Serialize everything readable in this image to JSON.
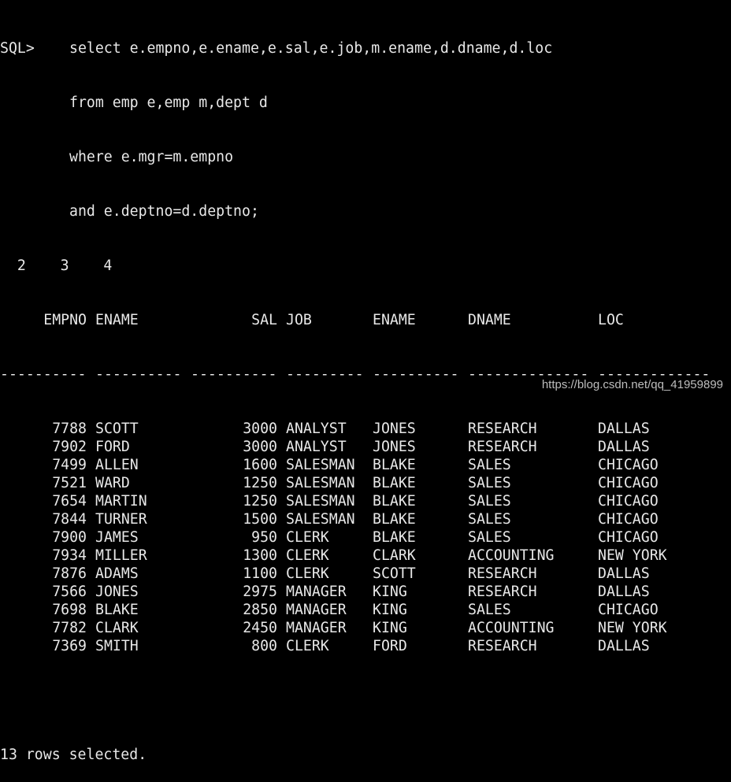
{
  "terminal": {
    "prompt": "SQL>",
    "query_lines": [
      "select e.empno,e.ename,e.sal,e.job,m.ename,d.dname,d.loc",
      "from emp e,emp m,dept d",
      "where e.mgr=m.empno",
      "and e.deptno=d.deptno;"
    ],
    "line_numbers": "  2    3    4",
    "columns": [
      "EMPNO",
      "ENAME",
      "SAL",
      "JOB",
      "ENAME",
      "DNAME",
      "LOC"
    ],
    "separators": [
      "----------",
      "----------",
      "----------",
      "---------",
      "----------",
      "--------------",
      "-------------"
    ],
    "rows": [
      [
        "7788",
        "SCOTT",
        "3000",
        "ANALYST",
        "JONES",
        "RESEARCH",
        "DALLAS"
      ],
      [
        "7902",
        "FORD",
        "3000",
        "ANALYST",
        "JONES",
        "RESEARCH",
        "DALLAS"
      ],
      [
        "7499",
        "ALLEN",
        "1600",
        "SALESMAN",
        "BLAKE",
        "SALES",
        "CHICAGO"
      ],
      [
        "7521",
        "WARD",
        "1250",
        "SALESMAN",
        "BLAKE",
        "SALES",
        "CHICAGO"
      ],
      [
        "7654",
        "MARTIN",
        "1250",
        "SALESMAN",
        "BLAKE",
        "SALES",
        "CHICAGO"
      ],
      [
        "7844",
        "TURNER",
        "1500",
        "SALESMAN",
        "BLAKE",
        "SALES",
        "CHICAGO"
      ],
      [
        "7900",
        "JAMES",
        "950",
        "CLERK",
        "BLAKE",
        "SALES",
        "CHICAGO"
      ],
      [
        "7934",
        "MILLER",
        "1300",
        "CLERK",
        "CLARK",
        "ACCOUNTING",
        "NEW YORK"
      ],
      [
        "7876",
        "ADAMS",
        "1100",
        "CLERK",
        "SCOTT",
        "RESEARCH",
        "DALLAS"
      ],
      [
        "7566",
        "JONES",
        "2975",
        "MANAGER",
        "KING",
        "RESEARCH",
        "DALLAS"
      ],
      [
        "7698",
        "BLAKE",
        "2850",
        "MANAGER",
        "KING",
        "SALES",
        "CHICAGO"
      ],
      [
        "7782",
        "CLARK",
        "2450",
        "MANAGER",
        "KING",
        "ACCOUNTING",
        "NEW YORK"
      ],
      [
        "7369",
        "SMITH",
        "800",
        "CLERK",
        "FORD",
        "RESEARCH",
        "DALLAS"
      ]
    ],
    "footer": "13 rows selected."
  },
  "watermark": "https://blog.csdn.net/qq_41959899"
}
